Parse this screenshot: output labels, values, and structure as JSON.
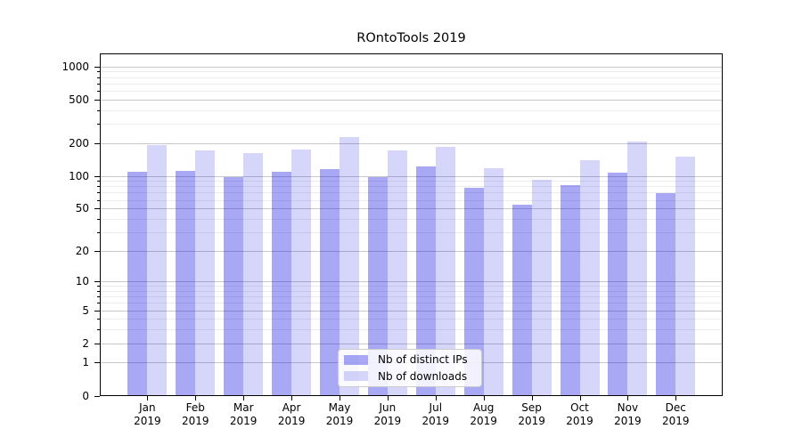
{
  "title": "ROntoTools 2019",
  "chart_data": {
    "type": "bar",
    "title": "ROntoTools 2019",
    "categories": [
      "Jan 2019",
      "Feb 2019",
      "Mar 2019",
      "Apr 2019",
      "May 2019",
      "Jun 2019",
      "Jul 2019",
      "Aug 2019",
      "Sep 2019",
      "Oct 2019",
      "Nov 2019",
      "Dec 2019"
    ],
    "series": [
      {
        "name": "Nb of distinct IPs",
        "fill": "rgba(0,0,225,0.34)",
        "swatch_hex": "#aaaaf3",
        "values": [
          110,
          112,
          98,
          110,
          116,
          97,
          122,
          78,
          54,
          82,
          106,
          69
        ]
      },
      {
        "name": "Nb of downloads",
        "fill": "rgba(0,0,225,0.16)",
        "swatch_hex": "#d8d8f9",
        "values": [
          193,
          172,
          161,
          175,
          225,
          170,
          185,
          118,
          92,
          140,
          205,
          150
        ]
      }
    ],
    "xlabel": "",
    "ylabel": "",
    "y_axis_ticks": [
      0,
      1,
      2,
      5,
      10,
      20,
      50,
      100,
      200,
      500,
      1000
    ],
    "y_axis_minor_ticks": [
      3,
      4,
      6,
      7,
      8,
      9,
      30,
      40,
      60,
      70,
      80,
      90,
      300,
      400,
      600,
      700,
      800,
      900
    ],
    "scale": "log10(value+1)",
    "ylim": [
      0,
      1320
    ],
    "grid": true,
    "legend_position": "bottom-center",
    "grid_major_color": "#c8c8c8",
    "grid_minor_color": "#ececec"
  }
}
